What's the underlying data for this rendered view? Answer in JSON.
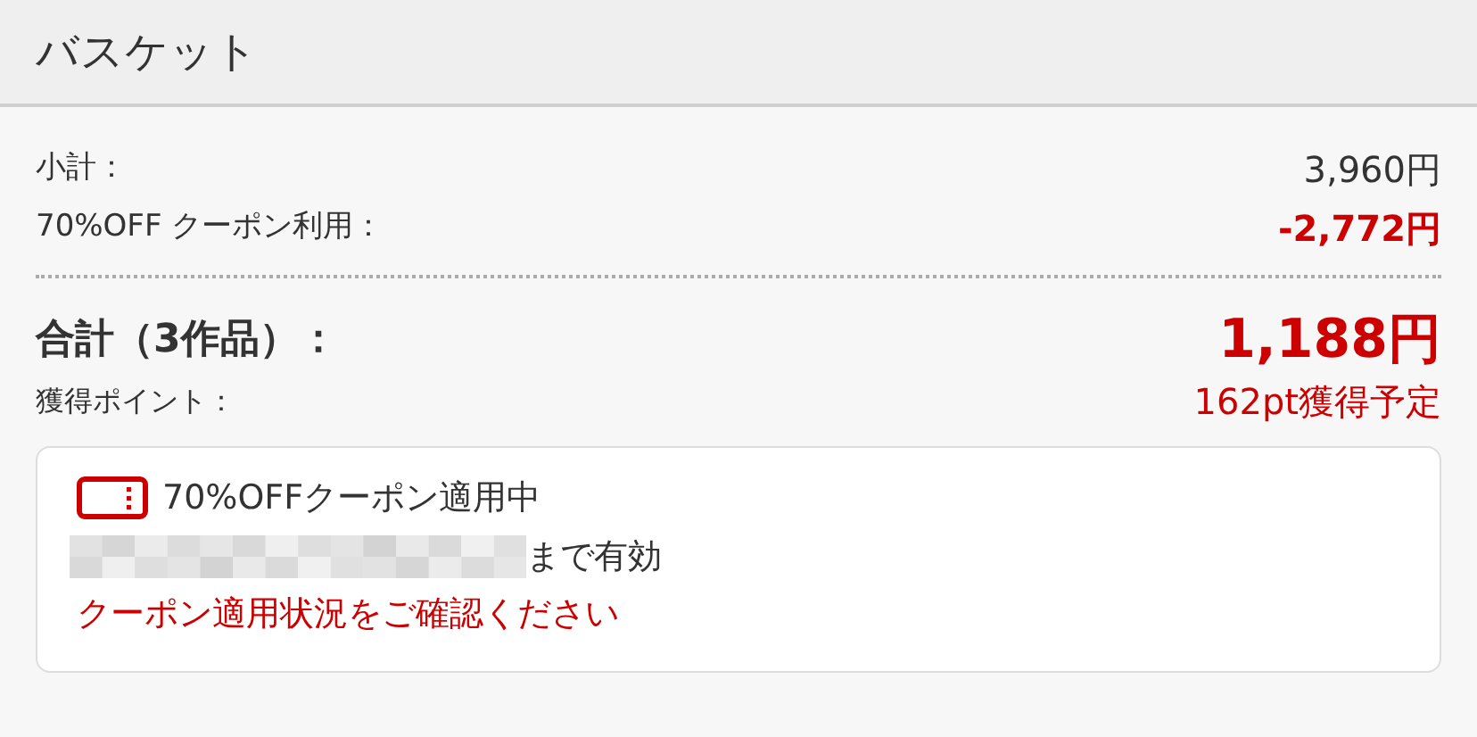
{
  "header": {
    "title": "バスケット"
  },
  "summary": [
    {
      "label": "小計：",
      "value": "3,960円",
      "kind": "plain"
    },
    {
      "label": "70%OFF クーポン利用：",
      "value": "-2,772円",
      "kind": "discount"
    }
  ],
  "total": {
    "label": "合計（3作品）：",
    "value": "1,188円"
  },
  "points": {
    "label": "獲得ポイント：",
    "value": "162pt獲得予定"
  },
  "coupon": {
    "title": "70%OFFクーポン適用中",
    "validity": "まで有効",
    "notice": "クーポン適用状況をご確認ください"
  }
}
